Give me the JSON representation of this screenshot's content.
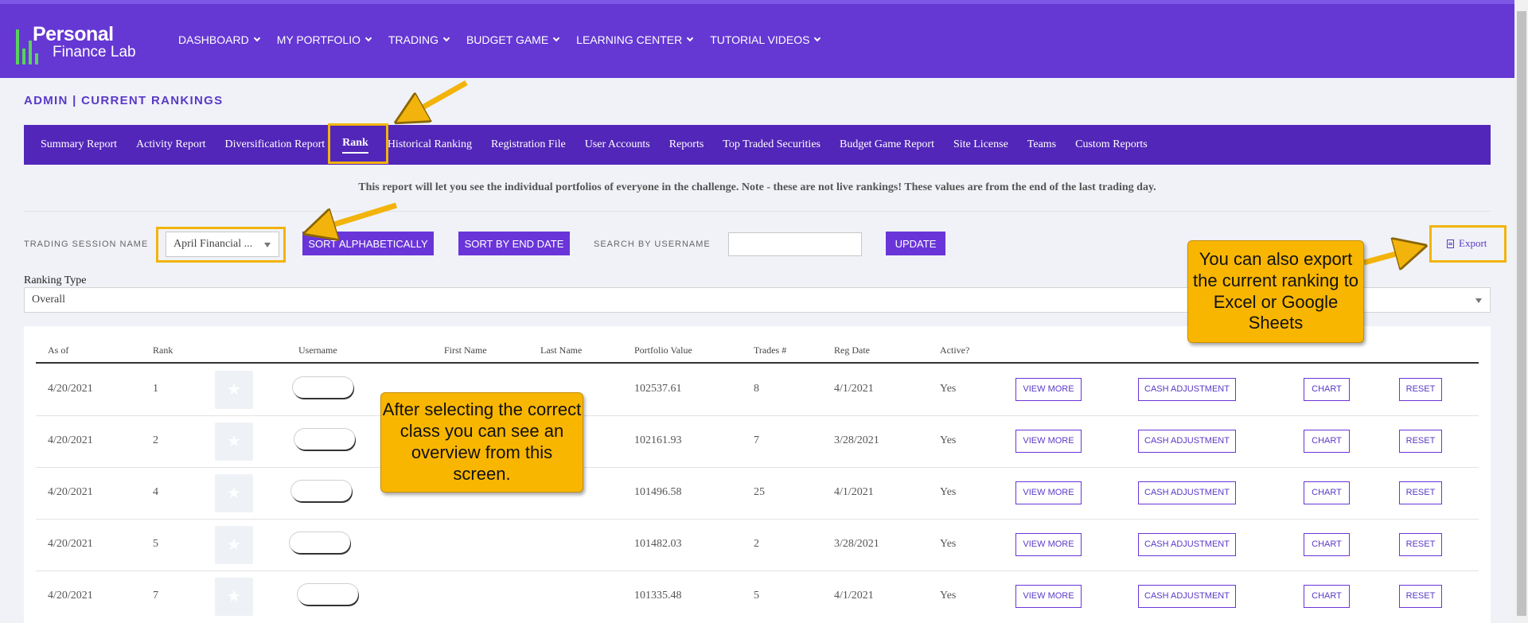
{
  "header": {
    "logo_line1": "Personal",
    "logo_line2": "Finance Lab",
    "nav": [
      "DASHBOARD",
      "MY PORTFOLIO",
      "TRADING",
      "BUDGET GAME",
      "LEARNING CENTER",
      "TUTORIAL VIDEOS"
    ]
  },
  "page_title": "ADMIN | CURRENT RANKINGS",
  "subnav": {
    "tabs": [
      "Summary Report",
      "Activity Report",
      "Diversification Report",
      "Rank",
      "Historical Ranking",
      "Registration File",
      "User Accounts",
      "Reports",
      "Top Traded Securities",
      "Budget Game Report",
      "Site License",
      "Teams",
      "Custom Reports"
    ],
    "active": "Rank"
  },
  "notice": "This report will let you see the individual portfolios of everyone in the challenge. Note - these are not live rankings! These values are from the end of the last trading day.",
  "filters": {
    "session_label": "TRADING SESSION NAME",
    "session_value": "April Financial ...",
    "sort_alpha": "SORT ALPHABETICALLY",
    "sort_end": "SORT BY END DATE",
    "search_label": "SEARCH BY USERNAME",
    "search_value": "",
    "update": "UPDATE",
    "export": "Export"
  },
  "ranking_type": {
    "label": "Ranking Type",
    "value": "Overall"
  },
  "table": {
    "headers": [
      "As of",
      "Rank",
      "Username",
      "First Name",
      "Last Name",
      "Portfolio Value",
      "Trades #",
      "Reg Date",
      "Active?"
    ],
    "rows": [
      {
        "as_of": "4/20/2021",
        "rank": "1",
        "value": "102537.61",
        "trades": "8",
        "reg": "4/1/2021",
        "active": "Yes"
      },
      {
        "as_of": "4/20/2021",
        "rank": "2",
        "value": "102161.93",
        "trades": "7",
        "reg": "3/28/2021",
        "active": "Yes"
      },
      {
        "as_of": "4/20/2021",
        "rank": "4",
        "value": "101496.58",
        "trades": "25",
        "reg": "4/1/2021",
        "active": "Yes"
      },
      {
        "as_of": "4/20/2021",
        "rank": "5",
        "value": "101482.03",
        "trades": "2",
        "reg": "3/28/2021",
        "active": "Yes"
      },
      {
        "as_of": "4/20/2021",
        "rank": "7",
        "value": "101335.48",
        "trades": "5",
        "reg": "4/1/2021",
        "active": "Yes"
      }
    ],
    "actions": [
      "VIEW MORE",
      "CASH ADJUSTMENT",
      "CHART",
      "RESET"
    ]
  },
  "callouts": {
    "overview": "After selecting the correct class you can see an overview from this screen.",
    "export": "You can also export the current ranking to Excel or Google Sheets"
  },
  "colors": {
    "header": "#6537d3",
    "subnav": "#5226b8",
    "accent": "#6a35d8",
    "highlight": "#f9b600",
    "logo_bars": "#59d35c"
  }
}
